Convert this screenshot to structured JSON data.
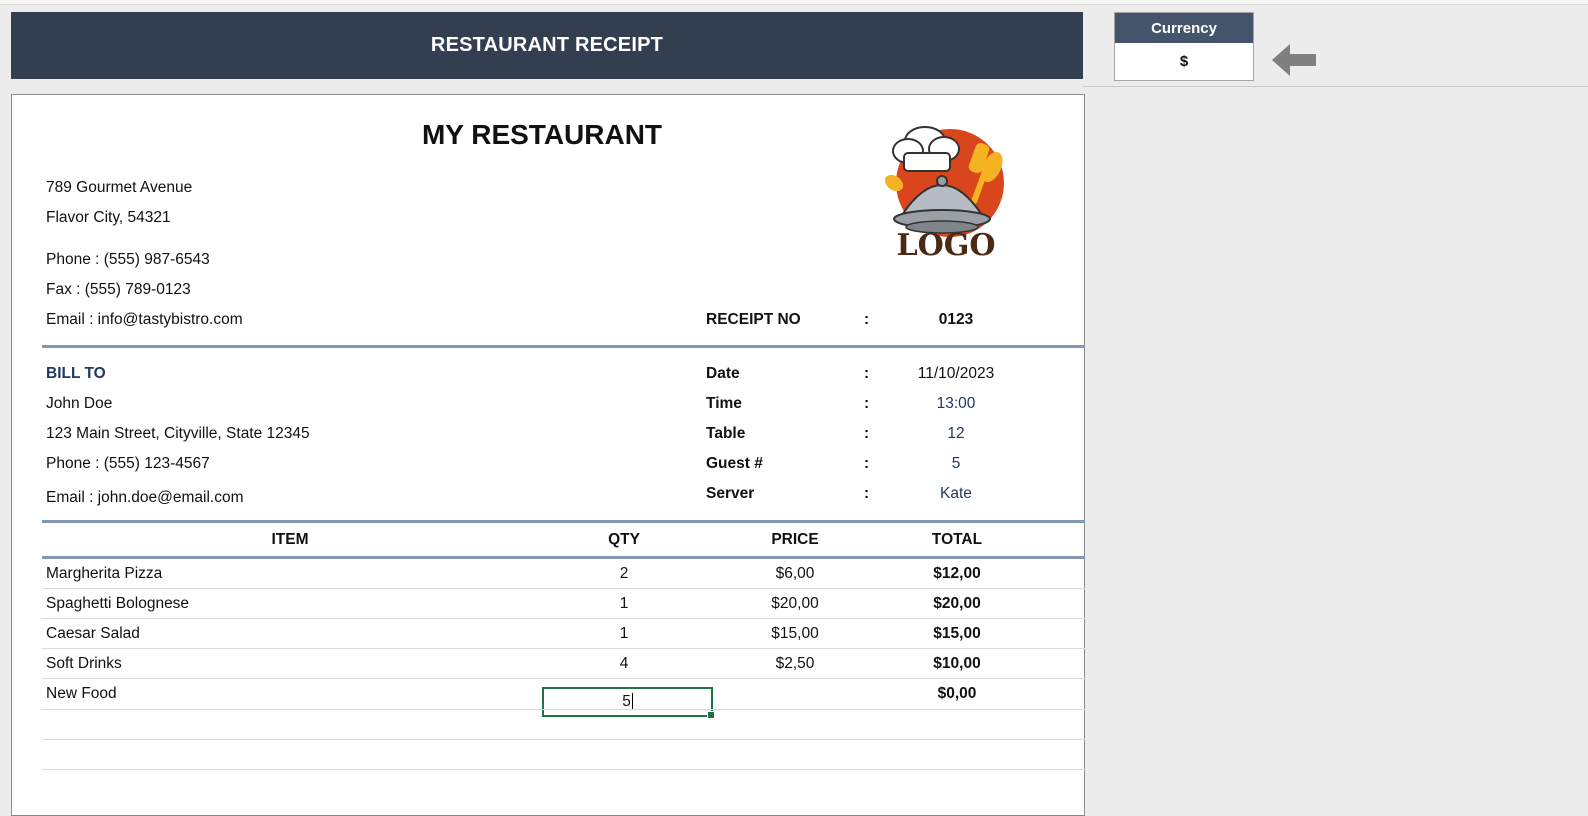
{
  "header": {
    "title": "RESTAURANT RECEIPT"
  },
  "currency": {
    "label": "Currency",
    "value": "$"
  },
  "icons": {
    "arrow": "arrow-left-icon",
    "logo": "chef-cloche-logo"
  },
  "colors": {
    "header_bg": "#333f50",
    "currency_head_bg": "#44546a",
    "accent_line": "#8497b0",
    "label_blue": "#1f3864",
    "selection": "#217346"
  },
  "restaurant": {
    "name": "MY RESTAURANT",
    "address1": "789 Gourmet Avenue",
    "address2": "Flavor City,  54321",
    "phone": "Phone : (555) 987-6543",
    "fax": "Fax : (555) 789-0123",
    "email": "Email : info@tastybistro.com",
    "logo_text": "LOGO"
  },
  "receipt": {
    "label": "RECEIPT NO",
    "sep": ":",
    "value": "0123"
  },
  "bill_to": {
    "label": "BILL TO",
    "name": "John Doe",
    "address": "123 Main Street, Cityville, State 12345",
    "phone": "Phone : (555) 123-4567",
    "email": "Email : john.doe@email.com"
  },
  "details": [
    {
      "label": "Date",
      "sep": ":",
      "value": "11/10/2023"
    },
    {
      "label": "Time",
      "sep": ":",
      "value": "13:00"
    },
    {
      "label": "Table",
      "sep": ":",
      "value": "12"
    },
    {
      "label": "Guest #",
      "sep": ":",
      "value": "5"
    },
    {
      "label": "Server",
      "sep": ":",
      "value": "Kate"
    }
  ],
  "table": {
    "headers": [
      "ITEM",
      "QTY",
      "PRICE",
      "TOTAL"
    ],
    "rows": [
      {
        "item": "Margherita Pizza",
        "qty": "2",
        "price": "$6,00",
        "total": "$12,00"
      },
      {
        "item": "Spaghetti Bolognese",
        "qty": "1",
        "price": "$20,00",
        "total": "$20,00"
      },
      {
        "item": "Caesar Salad",
        "qty": "1",
        "price": "$15,00",
        "total": "$15,00"
      },
      {
        "item": "Soft Drinks",
        "qty": "4",
        "price": "$2,50",
        "total": "$10,00"
      },
      {
        "item": "New Food",
        "qty": "5",
        "price": "",
        "total": "$0,00"
      }
    ]
  }
}
